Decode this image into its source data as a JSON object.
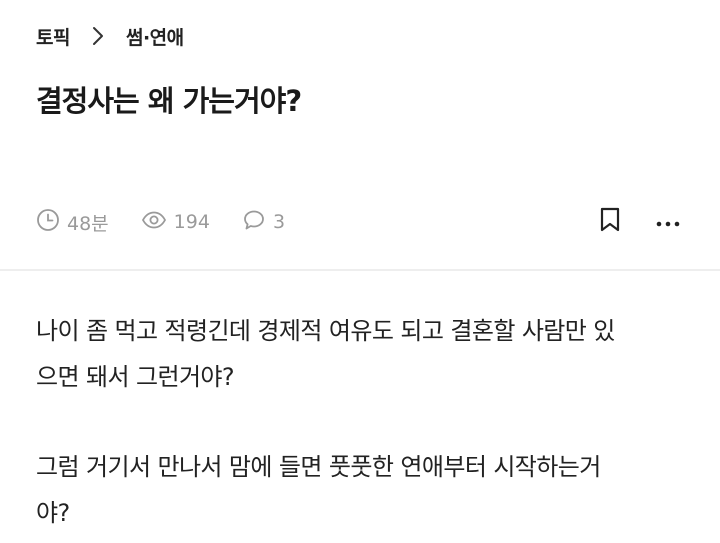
{
  "breadcrumb": {
    "root": "토픽",
    "current": "썸·연애"
  },
  "post": {
    "title": "결정사는 왜 가는거야?",
    "meta": {
      "time": "48분",
      "views": "194",
      "comments": "3"
    },
    "body": {
      "para1_line1": "나이 좀 먹고 적령긴데 경제적 여유도 되고 결혼할 사람만 있",
      "para1_line2": "으면 돼서 그런거야?",
      "para2_line1": "그럼 거기서 만나서 맘에 들면 풋풋한 연애부터 시작하는거",
      "para2_line2": "야?"
    }
  },
  "icons": {
    "separator": "chevron-right-icon",
    "time": "clock-icon",
    "views": "eye-icon",
    "comments": "speech-bubble-icon",
    "bookmark": "bookmark-icon",
    "more": "more-horizontal-icon"
  },
  "colors": {
    "text": "#222222",
    "meta": "#9a9a9a",
    "divider": "#eeeeee"
  }
}
